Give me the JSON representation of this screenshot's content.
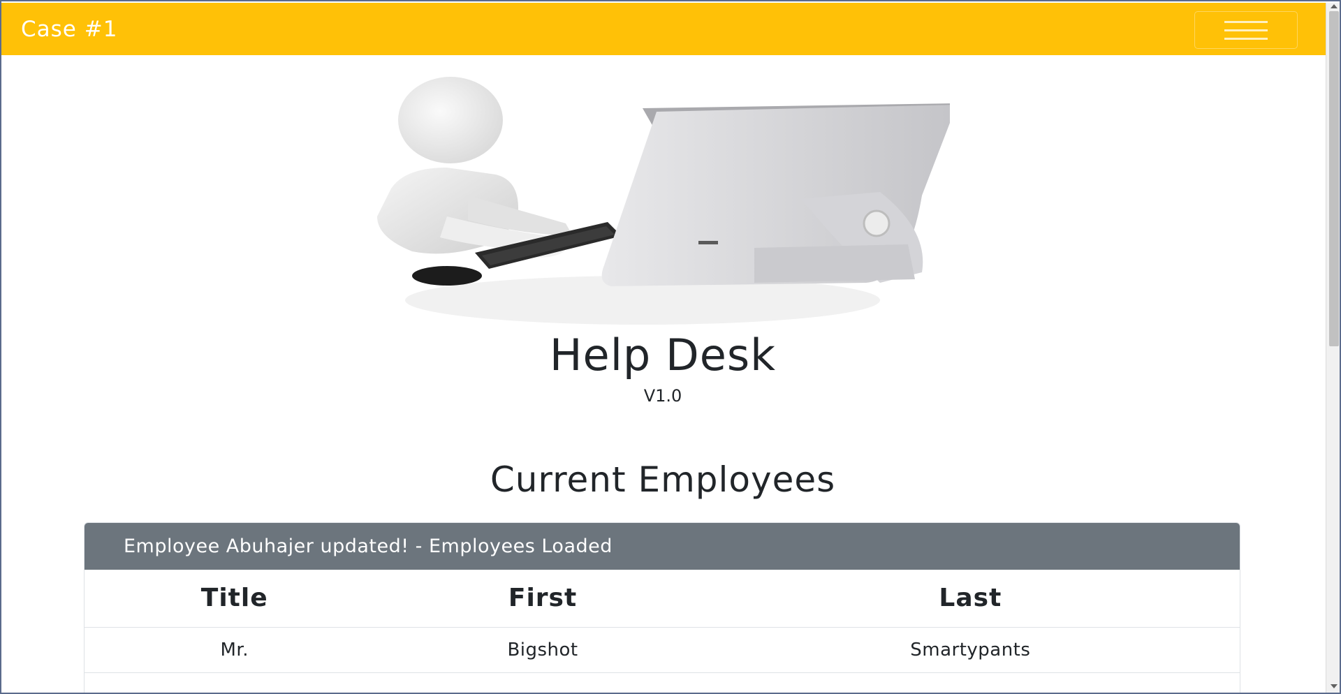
{
  "navbar": {
    "brand": "Case #1",
    "brand_color": "#ffc107",
    "toggler_icon": "hamburger-menu-icon"
  },
  "hero": {
    "image": "person-at-computer-illustration"
  },
  "header": {
    "title": "Help Desk",
    "version": "V1.0"
  },
  "employees": {
    "heading": "Current Employees",
    "status_message": "Employee Abuhajer updated! - Employees Loaded",
    "columns": [
      "Title",
      "First",
      "Last"
    ],
    "rows": [
      [
        "Mr.",
        "Bigshot",
        "Smartypants"
      ]
    ]
  }
}
